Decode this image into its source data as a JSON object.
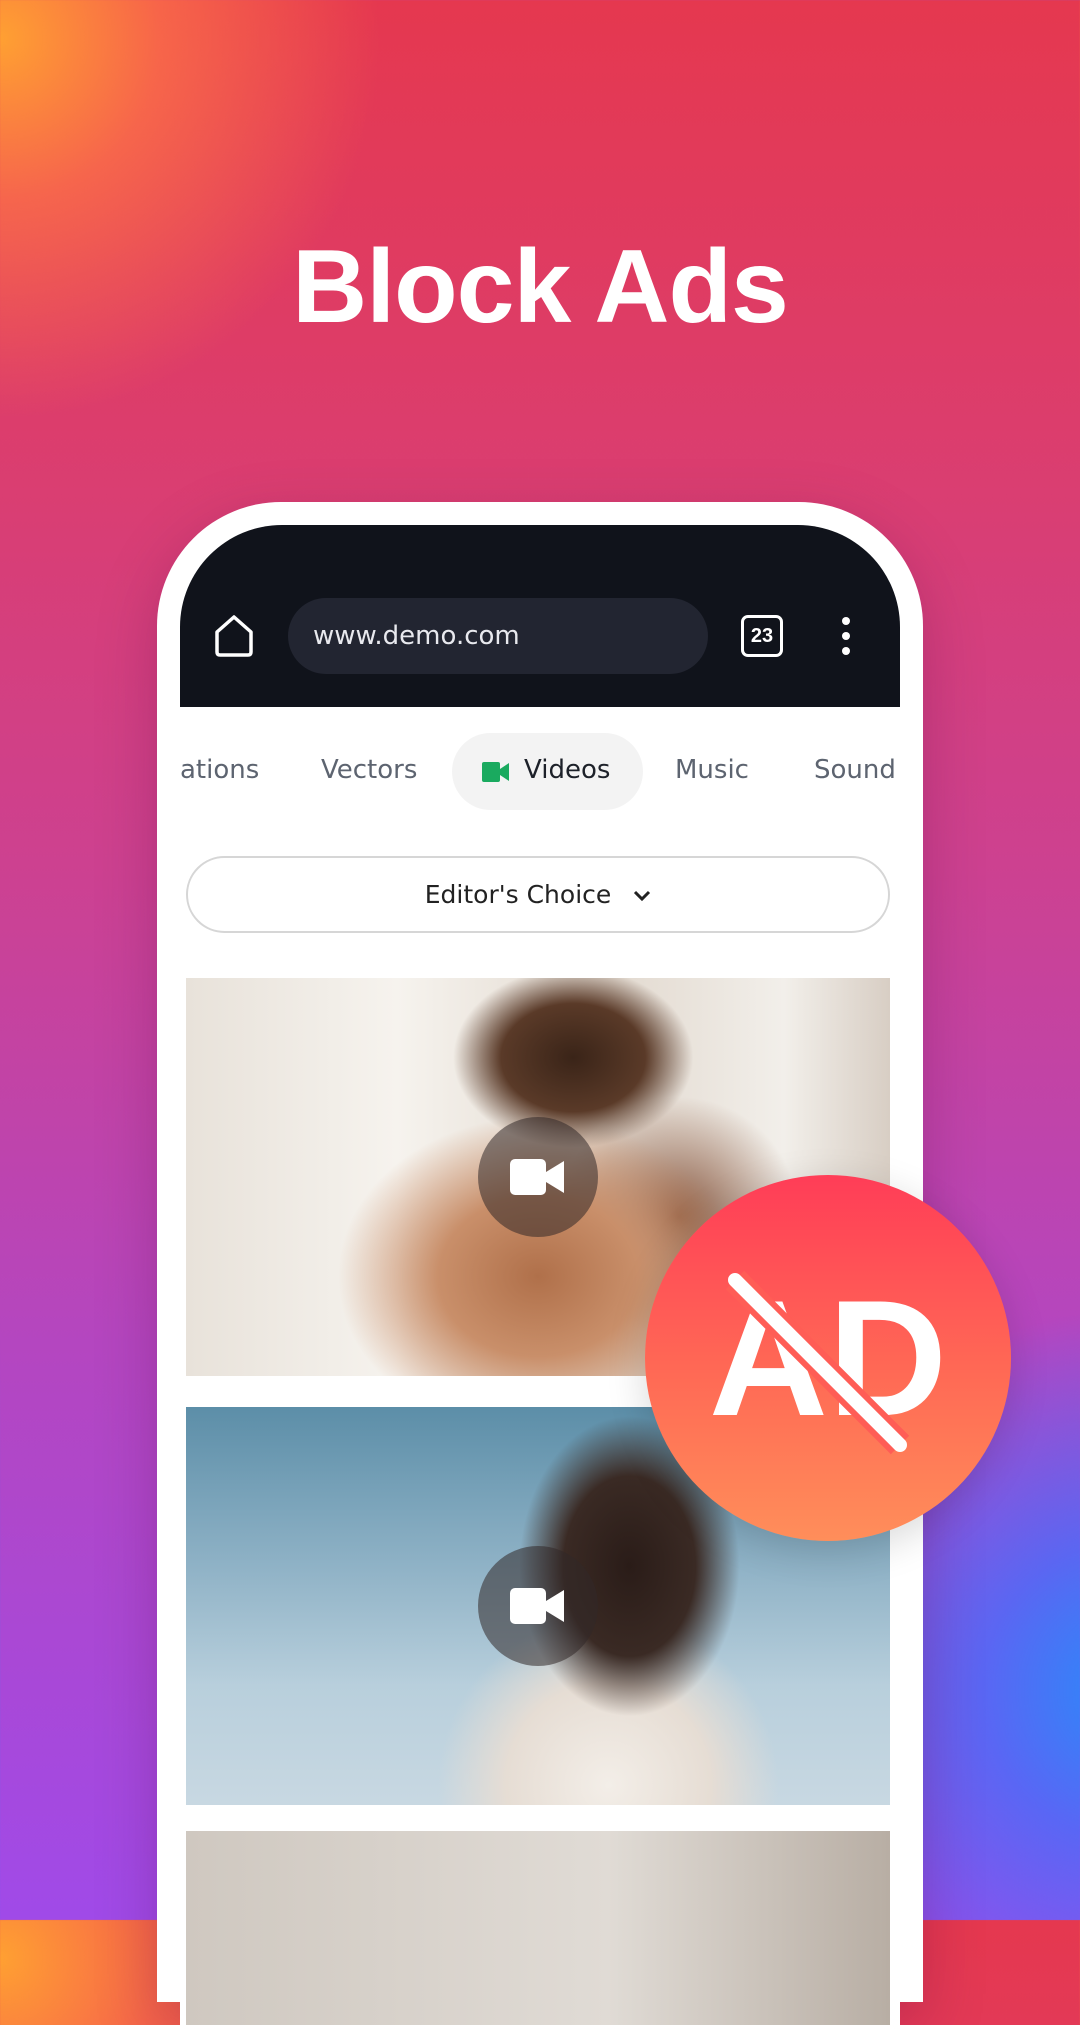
{
  "headline": "Block Ads",
  "browser": {
    "url": "www.demo.com",
    "tab_count": "23",
    "icons": {
      "home": "home-icon",
      "tabs": "tabs-counter-icon",
      "menu": "more-vertical-icon"
    }
  },
  "category_tabs": [
    {
      "label": "ations"
    },
    {
      "label": "Vectors"
    },
    {
      "label": "Videos",
      "active": true,
      "icon": "video-camera-icon"
    },
    {
      "label": "Music"
    },
    {
      "label": "Sound"
    }
  ],
  "sort_dropdown": {
    "label": "Editor's Choice",
    "icon": "chevron-down-icon"
  },
  "results": [
    {
      "type": "video",
      "icon": "video-camera-icon"
    },
    {
      "type": "video",
      "icon": "video-camera-icon"
    },
    {
      "type": "image"
    }
  ],
  "ad_block_badge": {
    "text": "AD",
    "icon": "ad-blocked-icon"
  },
  "colors": {
    "active_tab_icon": "#1aaa5f",
    "browser_bar": "#10131b",
    "badge_top": "#ff3d57",
    "badge_bottom": "#ff8e5a"
  }
}
